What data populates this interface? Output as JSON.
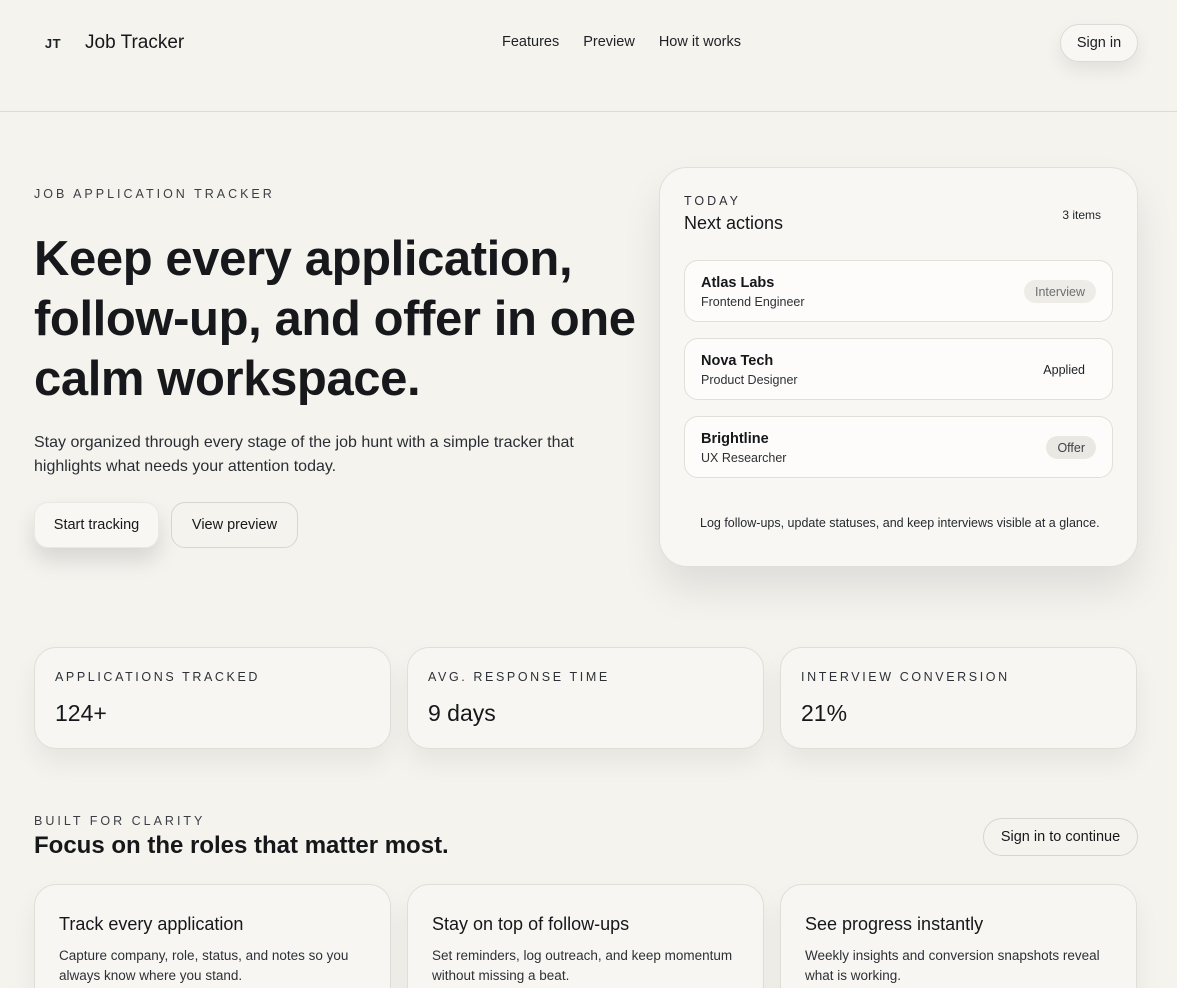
{
  "header": {
    "logo_text": "JT",
    "brand": "Job Tracker",
    "nav": [
      "Features",
      "Preview",
      "How it works"
    ],
    "signin_label": "Sign in"
  },
  "hero": {
    "eyebrow": "JOB APPLICATION TRACKER",
    "title": "Keep every application, follow-up, and offer in one calm workspace.",
    "subtitle": "Stay organized through every stage of the job hunt with a simple tracker that highlights what needs your attention today.",
    "primary_cta": "Start tracking",
    "secondary_cta": "View preview"
  },
  "today": {
    "eyebrow": "TODAY",
    "title": "Next actions",
    "count": "3 items",
    "items": [
      {
        "company": "Atlas Labs",
        "role": "Frontend Engineer",
        "status": "Interview"
      },
      {
        "company": "Nova Tech",
        "role": "Product Designer",
        "status": "Applied"
      },
      {
        "company": "Brightline",
        "role": "UX Researcher",
        "status": "Offer"
      }
    ],
    "note": "Log follow-ups, update statuses, and keep interviews visible at a glance."
  },
  "stats": [
    {
      "label": "APPLICATIONS TRACKED",
      "value": "124+"
    },
    {
      "label": "AVG. RESPONSE TIME",
      "value": "9 days"
    },
    {
      "label": "INTERVIEW CONVERSION",
      "value": "21%"
    }
  ],
  "features": {
    "eyebrow": "BUILT FOR CLARITY",
    "title": "Focus on the roles that matter most.",
    "cta": "Sign in to continue",
    "cards": [
      {
        "title": "Track every application",
        "desc": "Capture company, role, status, and notes so you always know where you stand."
      },
      {
        "title": "Stay on top of follow-ups",
        "desc": "Set reminders, log outreach, and keep momentum without missing a beat."
      },
      {
        "title": "See progress instantly",
        "desc": "Weekly insights and conversion snapshots reveal what is working."
      }
    ]
  }
}
